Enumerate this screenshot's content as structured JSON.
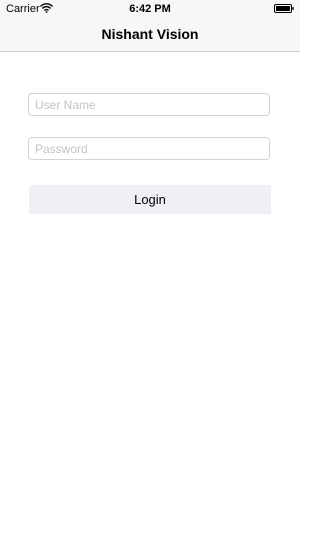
{
  "status_bar": {
    "carrier": "Carrier",
    "time": "6:42 PM",
    "wifi_icon": "wifi-icon",
    "battery_icon": "battery-icon"
  },
  "nav": {
    "title": "Nishant Vision"
  },
  "form": {
    "username": {
      "value": "",
      "placeholder": "User Name"
    },
    "password": {
      "value": "",
      "placeholder": "Password"
    },
    "login_label": "Login"
  },
  "colors": {
    "bar_background": "#f7f7f7",
    "button_background": "#efeff4",
    "field_border": "#d4d4d4",
    "placeholder": "#c2c2c7"
  }
}
